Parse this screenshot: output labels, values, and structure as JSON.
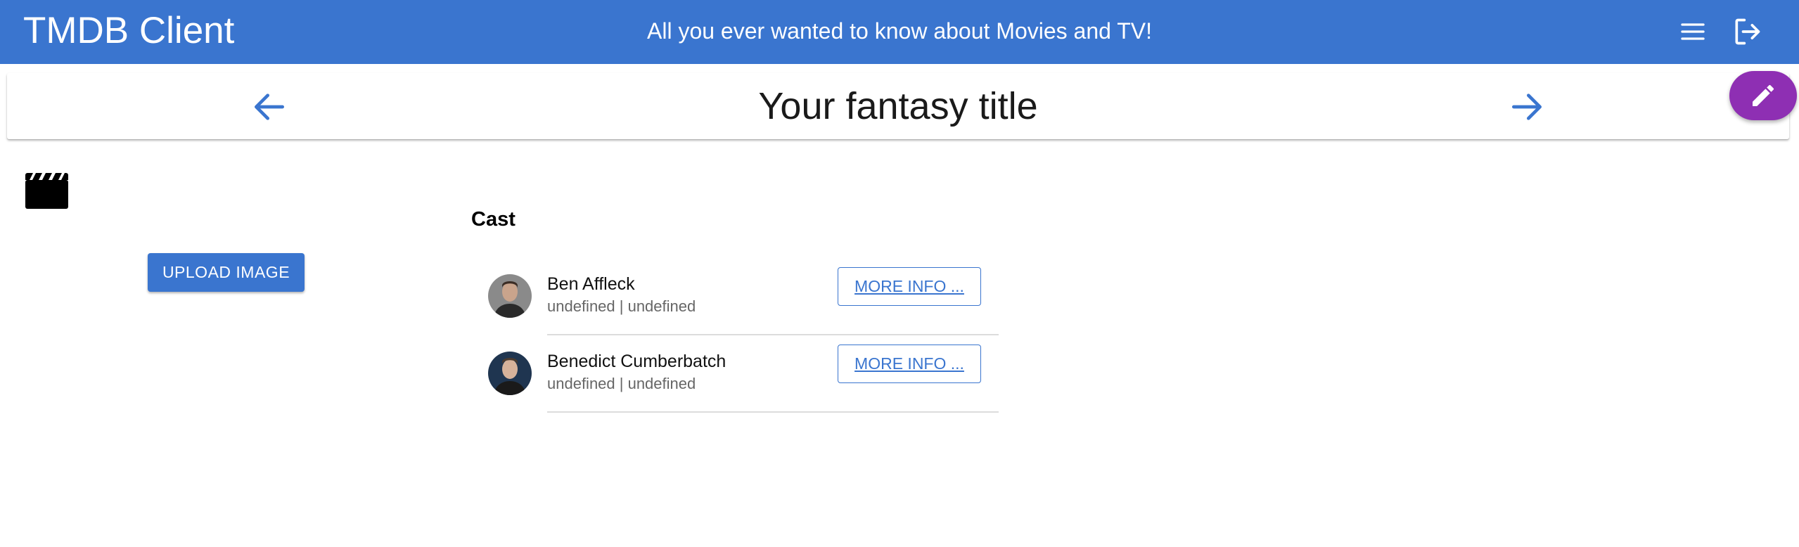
{
  "app": {
    "title": "TMDB Client",
    "tagline": "All you ever wanted to know about Movies and TV!",
    "colors": {
      "primary": "#3a75cf",
      "accent": "#8e2fb3"
    },
    "icons": {
      "menu": "menu-icon",
      "logout": "logout-icon"
    }
  },
  "header": {
    "title": "Your fantasy title",
    "icons": {
      "back": "arrow-left-icon",
      "forward": "arrow-right-icon",
      "edit": "pencil-icon"
    }
  },
  "poster": {
    "icon": "clapperboard-icon",
    "upload_label": "UPLOAD IMAGE"
  },
  "cast": {
    "heading": "Cast",
    "more_label": "MORE INFO ...",
    "members": [
      {
        "name": "Ben Affleck",
        "subtitle": "undefined | undefined"
      },
      {
        "name": "Benedict Cumberbatch",
        "subtitle": "undefined | undefined"
      }
    ]
  }
}
